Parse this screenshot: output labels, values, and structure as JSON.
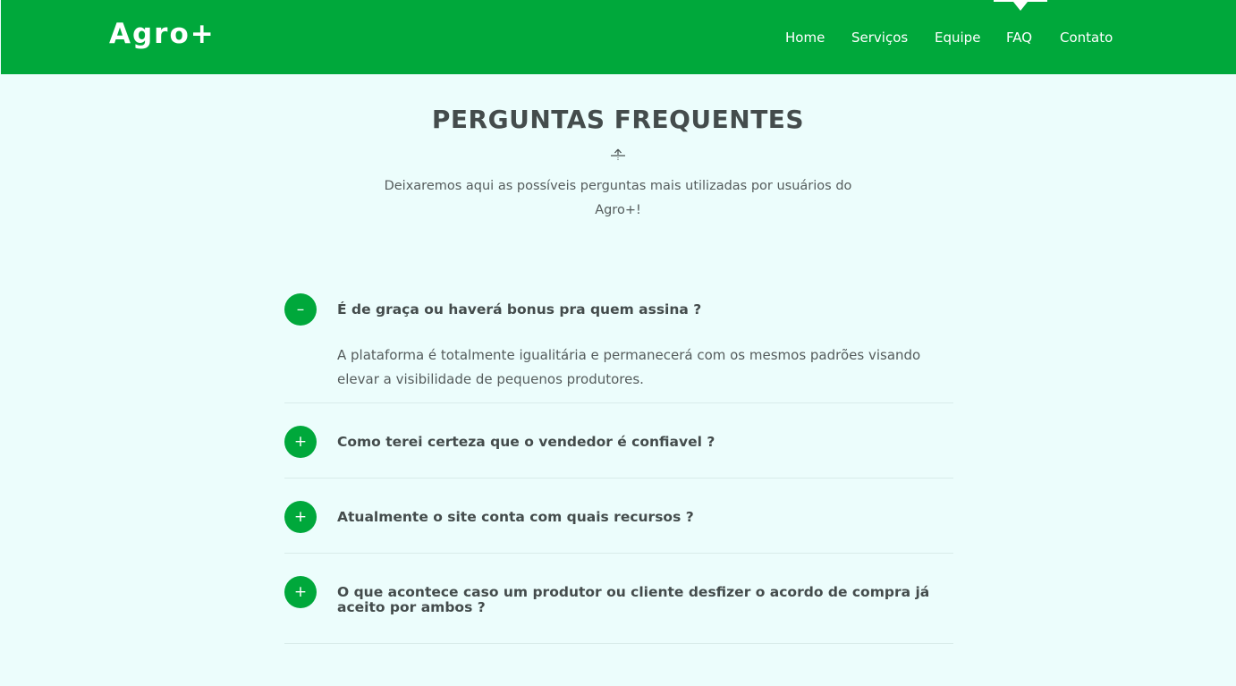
{
  "header": {
    "brand": "Agro+",
    "nav": [
      "Home",
      "Serviços",
      "Equipe",
      "FAQ",
      "Contato"
    ],
    "active_nav": "FAQ"
  },
  "section": {
    "title": "PERGUNTAS FREQUENTES",
    "divider_icon": "arrow-up-divider-icon",
    "subtitle": "Deixaremos aqui as possíveis perguntas mais utilizadas por usuários do Agro+!"
  },
  "faq": [
    {
      "icon": "–",
      "question": "É de graça ou haverá bonus pra quem assina ?",
      "answer": "A plataforma é totalmente igualitária e permanecerá com os mesmos padrões visando elevar a visibilidade de pequenos produtores.",
      "expanded": true
    },
    {
      "icon": "+",
      "question": "Como terei certeza que o vendedor é confiavel ?",
      "expanded": false
    },
    {
      "icon": "+",
      "question": "Atualmente o site conta com quais recursos ?",
      "expanded": false
    },
    {
      "icon": "+",
      "question": "O que acontece caso um produtor ou cliente desfizer o acordo de compra já aceito por ambos ?",
      "expanded": false
    }
  ],
  "colors": {
    "primary": "#00a83b",
    "background": "#ecfdfc",
    "heading": "#444c4c",
    "text": "#555c5c"
  }
}
